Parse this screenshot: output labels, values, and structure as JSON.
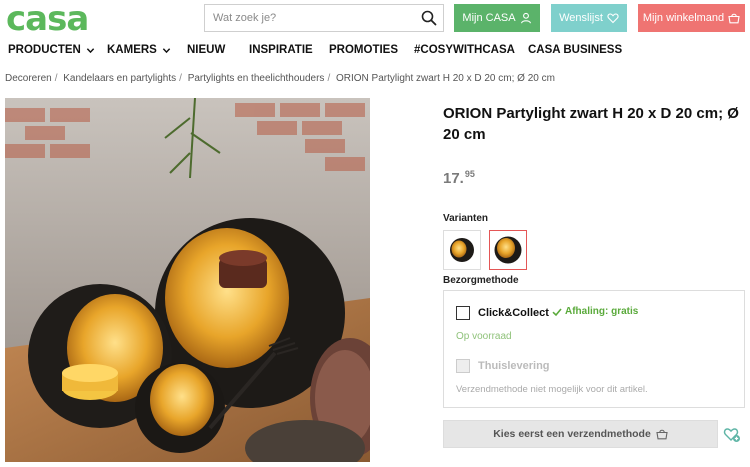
{
  "header": {
    "logo": "casa",
    "search": {
      "placeholder": "Wat zoek je?"
    },
    "my_casa": "Mijn CASA",
    "wishlist": "Wenslijst",
    "cart": "Mijn winkelmand",
    "colors": {
      "brand_green": "#5cb85c",
      "wishlist_teal": "#7fd0cc",
      "cart_red": "#ef7472"
    }
  },
  "nav": [
    {
      "label": "PRODUCTEN",
      "dropdown": true
    },
    {
      "label": "KAMERS",
      "dropdown": true
    },
    {
      "label": "NIEUW",
      "dropdown": false
    },
    {
      "label": "INSPIRATIE",
      "dropdown": false
    },
    {
      "label": "PROMOTIES",
      "dropdown": false
    },
    {
      "label": "#COSYWITHCASA",
      "dropdown": false
    },
    {
      "label": "CASA BUSINESS",
      "dropdown": false
    }
  ],
  "breadcrumb": [
    "Decoreren",
    "Kandelaars en partylights",
    "Partylights en theelichthouders",
    "ORION Partylight zwart H 20 x D 20 cm; Ø 20 cm"
  ],
  "product": {
    "title": "ORION Partylight zwart H 20 x D 20 cm; Ø 20 cm",
    "price_whole": "17.",
    "price_cents": "95",
    "variants_label": "Varianten",
    "delivery_label": "Bezorgmethode",
    "options": {
      "click_collect": "Click&Collect",
      "pickup_status": "Afhaling: gratis",
      "preorder": "Op voorraad",
      "home_delivery": "Thuislevering",
      "not_possible": "Verzendmethode niet mogelijk voor dit artikel."
    },
    "cta": "Kies eerst een verzendmethode"
  }
}
